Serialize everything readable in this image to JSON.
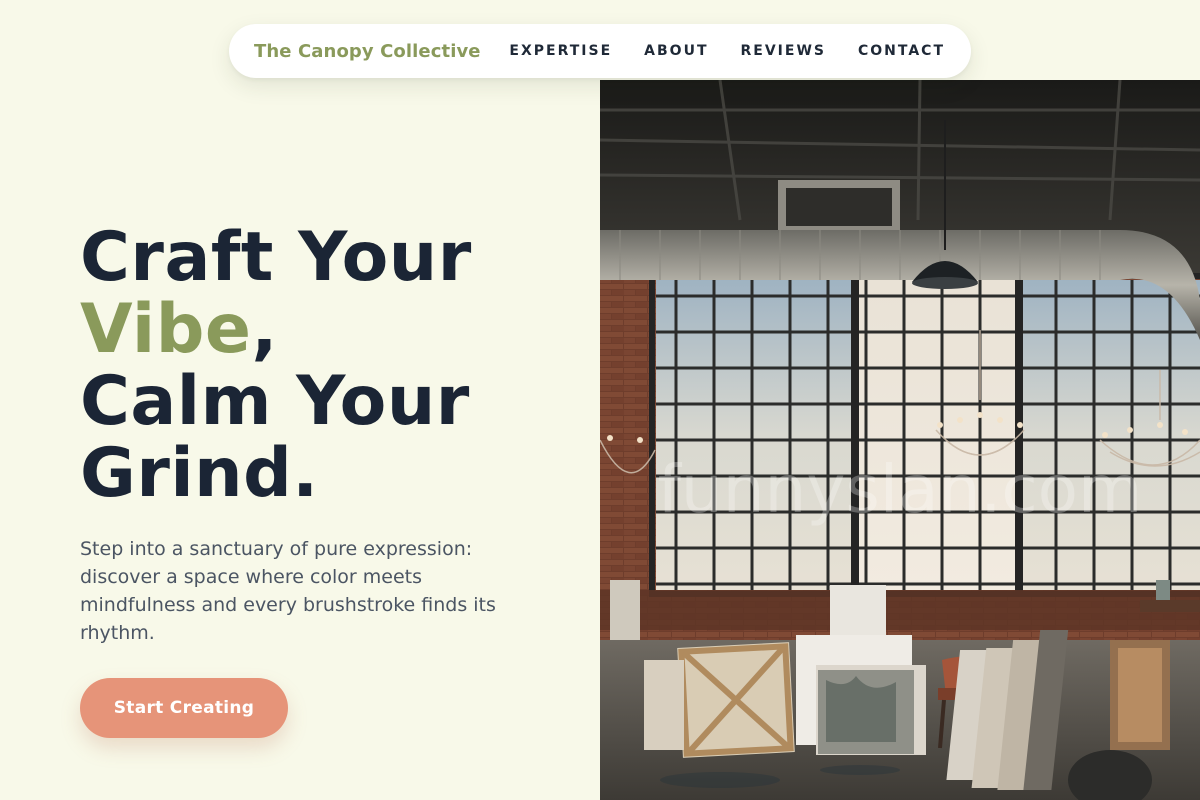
{
  "nav": {
    "brand": "The Canopy Collective",
    "links": [
      "EXPERTISE",
      "ABOUT",
      "REVIEWS",
      "CONTACT"
    ]
  },
  "hero": {
    "title_line1": "Craft Your",
    "title_accent": "Vibe",
    "title_comma": ",",
    "title_line3": "Calm Your",
    "title_line4": "Grind.",
    "subtitle": "Step into a sanctuary of pure expression: discover a space where color meets mindfulness and every brushstroke finds its rhythm.",
    "cta_label": "Start Creating"
  },
  "image": {
    "watermark": "funnyslan.com",
    "subject": "industrial-loft-art-studio"
  },
  "colors": {
    "background": "#f8f9e9",
    "accent_green": "#8a9a5b",
    "heading": "#1b2535",
    "cta": "#e69479"
  }
}
